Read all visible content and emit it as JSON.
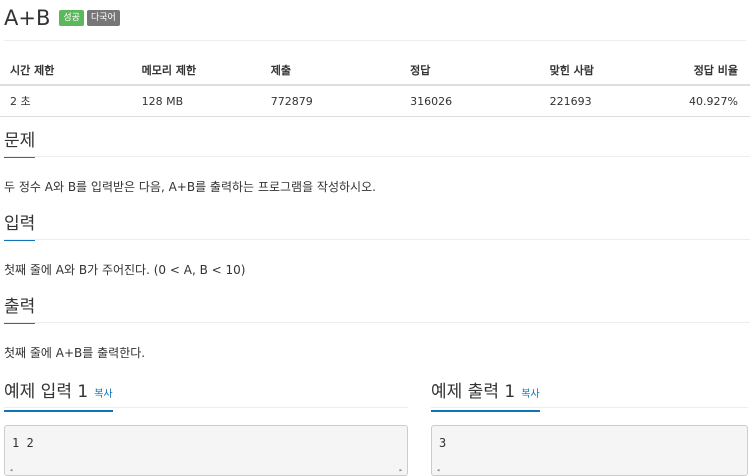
{
  "problem": {
    "title": "A+B",
    "badges": {
      "success": "성공",
      "multilang": "다국어"
    }
  },
  "info_table": {
    "headers": [
      "시간 제한",
      "메모리 제한",
      "제출",
      "정답",
      "맞힌 사람",
      "정답 비율"
    ],
    "rows": [
      [
        "2 초",
        "128 MB",
        "772879",
        "316026",
        "221693",
        "40.927%"
      ]
    ]
  },
  "sections": {
    "description": {
      "heading": "문제",
      "text": "두 정수 A와 B를 입력받은 다음, A+B를 출력하는 프로그램을 작성하시오."
    },
    "input": {
      "heading": "입력",
      "text": "첫째 줄에 A와 B가 주어진다. (0 < A, B < 10)"
    },
    "output": {
      "heading": "출력",
      "text": "첫째 줄에 A+B를 출력한다."
    }
  },
  "samples": {
    "input": {
      "heading": "예제 입력 1",
      "copy_label": "복사",
      "content": "1 2"
    },
    "output": {
      "heading": "예제 출력 1",
      "copy_label": "복사",
      "content": "3"
    }
  },
  "scroll_icons": {
    "left": "◂",
    "right": "▸"
  },
  "colors": {
    "accent": "#0e76b8",
    "success": "#5cb85c",
    "default_badge": "#777777"
  }
}
